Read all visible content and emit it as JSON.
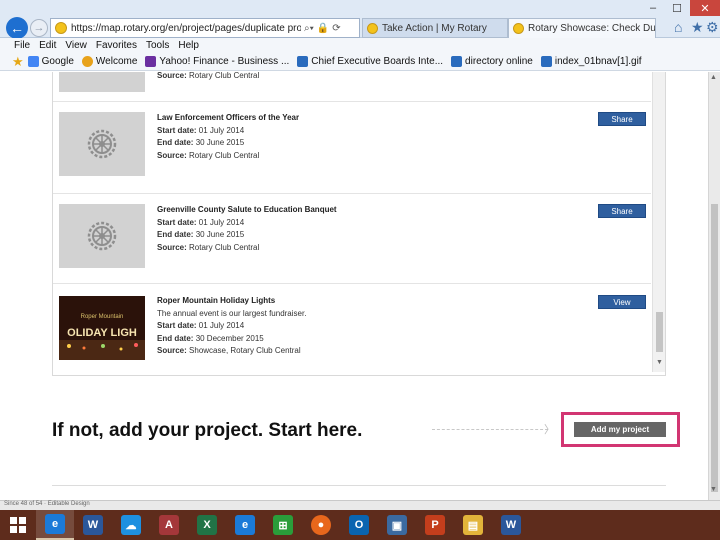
{
  "browser": {
    "url": "https://map.rotary.org/en/project/pages/duplicate project.as",
    "tabs": [
      {
        "label": "Take Action | My Rotary"
      },
      {
        "label": "Rotary Showcase: Check Du..."
      }
    ],
    "window_controls": {
      "minimize": "–",
      "maximize": "☐",
      "close": "✕"
    },
    "menu": [
      "File",
      "Edit",
      "View",
      "Favorites",
      "Tools",
      "Help"
    ],
    "favorites": [
      {
        "label": "Google",
        "icon": "google-icon",
        "color": "#4285f4"
      },
      {
        "label": "Welcome",
        "icon": "welcome-icon",
        "color": "#e8a21b"
      },
      {
        "label": "Yahoo! Finance - Business ...",
        "icon": "yahoo-icon",
        "color": "#6b2fa0"
      },
      {
        "label": "Chief Executive Boards Inte...",
        "icon": "page-icon",
        "color": "#2a6bbd"
      },
      {
        "label": "directory online",
        "icon": "page-icon",
        "color": "#2a6bbd"
      },
      {
        "label": "index_01bnav[1].gif",
        "icon": "image-icon",
        "color": "#2a6bbd"
      }
    ]
  },
  "projects": {
    "partial_row": {
      "source": "Source:",
      "source_value": "Rotary Club Central"
    },
    "rows": [
      {
        "title": "Law Enforcement Officers of the Year",
        "start_label": "Start date:",
        "start": "01 July 2014",
        "end_label": "End date:",
        "end": "30 June 2015",
        "source_label": "Source:",
        "source": "Rotary Club Central",
        "button": "Share"
      },
      {
        "title": "Greenville County Salute to Education Banquet",
        "start_label": "Start date:",
        "start": "01 July 2014",
        "end_label": "End date:",
        "end": "30 June 2015",
        "source_label": "Source:",
        "source": "Rotary Club Central",
        "button": "Share"
      },
      {
        "title": "Roper Mountain Holiday Lights",
        "description": "The annual event is our largest fundraiser.",
        "start_label": "Start date:",
        "start": "01 July 2014",
        "end_label": "End date:",
        "end": "30 December 2015",
        "source_label": "Source:",
        "source": "Showcase, Rotary Club Central",
        "button": "View"
      }
    ]
  },
  "cta": {
    "text": "If not, add your project. Start here.",
    "button": "Add my project",
    "highlight_color": "#d23572"
  },
  "status_bar": {
    "text": "Since 48 of 54 · Editable Design"
  },
  "taskbar": {
    "apps": [
      {
        "name": "internet-explorer",
        "letter": "e",
        "color": "#1b7ad8"
      },
      {
        "name": "word",
        "letter": "W",
        "color": "#2b579a"
      },
      {
        "name": "onedrive",
        "letter": "☁",
        "color": "#1e90e0"
      },
      {
        "name": "access",
        "letter": "A",
        "color": "#a4373a"
      },
      {
        "name": "excel",
        "letter": "X",
        "color": "#217346"
      },
      {
        "name": "internet-explorer-2",
        "letter": "e",
        "color": "#1b7ad8"
      },
      {
        "name": "store",
        "letter": "⊞",
        "color": "#2a9d3a"
      },
      {
        "name": "firefox",
        "letter": "●",
        "color": "#e8671c"
      },
      {
        "name": "outlook",
        "letter": "O",
        "color": "#0a64b0"
      },
      {
        "name": "remote-desktop",
        "letter": "▣",
        "color": "#3b6aa0"
      },
      {
        "name": "powerpoint",
        "letter": "P",
        "color": "#c43e1c"
      },
      {
        "name": "file-explorer",
        "letter": "▤",
        "color": "#e2b43a"
      },
      {
        "name": "word-2",
        "letter": "W",
        "color": "#2b579a"
      }
    ]
  }
}
